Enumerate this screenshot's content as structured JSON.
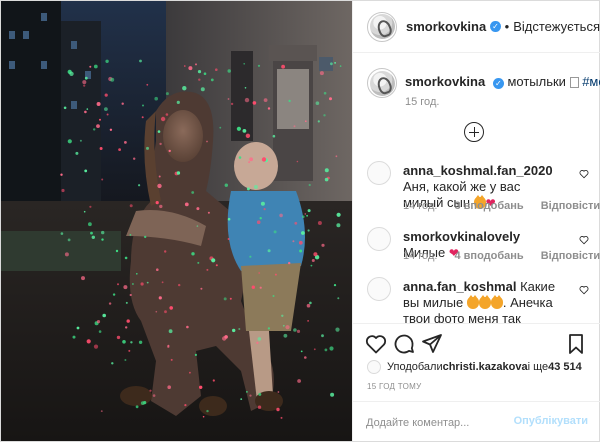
{
  "header": {
    "username": "smorkovkina",
    "follow_state": "Відстежується",
    "verified_glyph": "✓"
  },
  "caption": {
    "username": "smorkovkina",
    "text": "мотыльки ",
    "hashtag": "#мой",
    "time": "15 год."
  },
  "comments": [
    {
      "username": "anna_koshmal.fan_2020",
      "text": "Аня, какой же у вас милый сын",
      "time": "14 год.",
      "likes": "3 вподобань",
      "reply": "Відповісти"
    },
    {
      "username": "smorkovkinalovely",
      "text": "Милые",
      "time": "14 год.",
      "likes": "4 вподобань",
      "reply": "Відповісти"
    },
    {
      "username": "anna.fan_koshmal",
      "text": "Какие вы милые",
      "text2": ". Анечка твои фото меня так вдохновляют и"
    }
  ],
  "likes": {
    "prefix": "Уподобали ",
    "user": "christi.kazakova",
    "middle": " і ще ",
    "count": "43 514"
  },
  "post_time": "15 ГОД ТОМУ",
  "add_comment": {
    "placeholder": "Додайте коментар...",
    "button": "Опублікувати"
  },
  "icons": [
    "heart-icon",
    "comment-icon",
    "share-icon",
    "bookmark-icon",
    "add-comments-icon"
  ],
  "colors": {
    "link": "#00376b",
    "verified": "#3897f0",
    "publish_disabled": "#b2dffc",
    "heart": "#e0245e"
  }
}
